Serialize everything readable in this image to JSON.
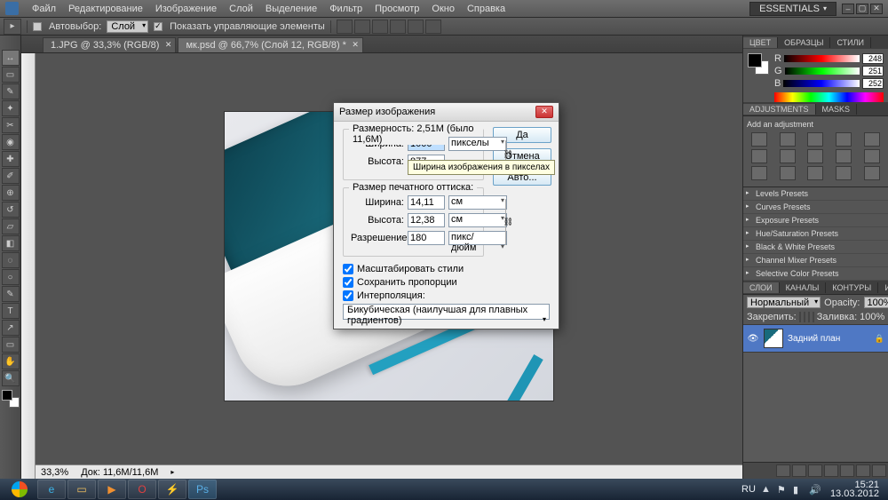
{
  "menubar": {
    "items": [
      "Файл",
      "Редактирование",
      "Изображение",
      "Слой",
      "Выделение",
      "Фильтр",
      "Просмотр",
      "Окно",
      "Справка"
    ],
    "workspace": "ESSENTIALS"
  },
  "optionsbar": {
    "autoselect_label": "Автовыбор:",
    "autoselect_value": "Слой",
    "show_controls_label": "Показать управляющие элементы"
  },
  "doctabs": [
    {
      "label": "1.JPG @ 33,3% (RGB/8)"
    },
    {
      "label": "мк.psd @ 66,7% (Слой 12, RGB/8) *"
    }
  ],
  "status": {
    "zoom": "33,3%",
    "info": "Док: 11,6M/11,6M"
  },
  "color_panel": {
    "tabs": [
      "ЦВЕТ",
      "ОБРАЗЦЫ",
      "СТИЛИ"
    ],
    "r": "248",
    "g": "251",
    "b": "252"
  },
  "adjustments": {
    "tabs": [
      "ADJUSTMENTS",
      "MASKS"
    ],
    "subtitle": "Add an adjustment",
    "presets": [
      "Levels Presets",
      "Curves Presets",
      "Exposure Presets",
      "Hue/Saturation Presets",
      "Black & White Presets",
      "Channel Mixer Presets",
      "Selective Color Presets"
    ]
  },
  "layers": {
    "tabs": [
      "СЛОИ",
      "КАНАЛЫ",
      "КОНТУРЫ",
      "ИСТОРИЯ"
    ],
    "blend_mode": "Нормальный",
    "opacity_label": "Opacity:",
    "opacity": "100%",
    "lock_label": "Закрепить:",
    "fill_label": "Заливка:",
    "fill": "100%",
    "layer_name": "Задний план"
  },
  "dialog": {
    "title": "Размер изображения",
    "dims_label": "Размерность:",
    "dims_value": "2,51M (было 11,6M)",
    "width_label": "Ширина:",
    "height_label": "Высота:",
    "width_val": "1000",
    "height_val": "877",
    "unit_px": "пикселы",
    "tooltip": "Ширина изображения в пикселах",
    "print_label": "Размер печатного оттиска:",
    "print_w": "14,11",
    "print_h": "12,38",
    "unit_cm": "см",
    "res_label": "Разрешение:",
    "res_val": "180",
    "unit_dpi": "пикс/дюйм",
    "scale_styles": "Масштабировать стили",
    "constrain": "Сохранить пропорции",
    "resample": "Интерполяция:",
    "resample_method": "Бикубическая (наилучшая для плавных градиентов)",
    "btn_ok": "Да",
    "btn_cancel": "Отмена",
    "btn_auto": "Авто..."
  },
  "taskbar": {
    "lang": "RU",
    "time": "15:21",
    "date": "13.03.2012"
  }
}
